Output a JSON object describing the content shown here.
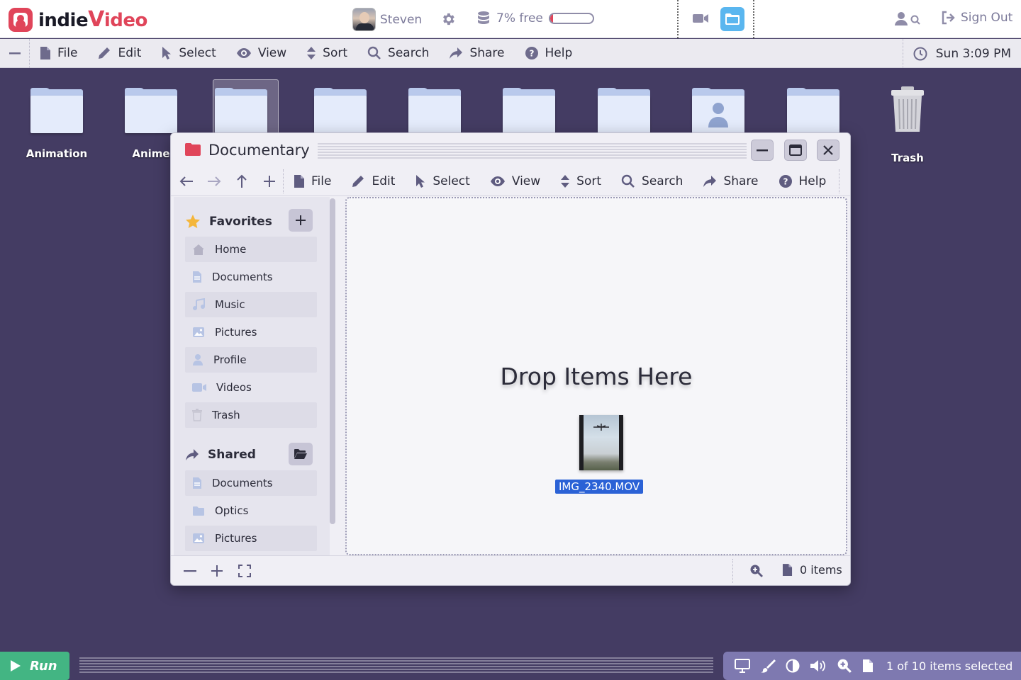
{
  "app": {
    "logo_indie": "indie",
    "logo_v": "V",
    "logo_ideo": "ideo"
  },
  "topbar": {
    "user_name": "Steven",
    "storage_text": "7% free",
    "storage_used_fraction": 0.07,
    "sign_out_label": "Sign Out"
  },
  "menubar": {
    "items": [
      {
        "label": "File",
        "icon": "file-icon"
      },
      {
        "label": "Edit",
        "icon": "pencil-icon"
      },
      {
        "label": "Select",
        "icon": "cursor-icon"
      },
      {
        "label": "View",
        "icon": "eye-icon"
      },
      {
        "label": "Sort",
        "icon": "sort-icon"
      },
      {
        "label": "Search",
        "icon": "search-icon"
      },
      {
        "label": "Share",
        "icon": "share-icon"
      },
      {
        "label": "Help",
        "icon": "help-icon"
      }
    ],
    "clock": "Sun 3:09 PM"
  },
  "desktop": {
    "icons": [
      {
        "label": "Animation",
        "type": "folder"
      },
      {
        "label": "Anime",
        "type": "folder"
      },
      {
        "label": "",
        "type": "folder",
        "selected": true
      },
      {
        "label": "",
        "type": "folder"
      },
      {
        "label": "",
        "type": "folder"
      },
      {
        "label": "",
        "type": "folder"
      },
      {
        "label": "",
        "type": "folder"
      },
      {
        "label": "",
        "type": "user-folder"
      },
      {
        "label": "",
        "type": "folder"
      },
      {
        "label": "Trash",
        "type": "trash"
      }
    ]
  },
  "window": {
    "title": "Documentary",
    "toolbar": {
      "items": [
        {
          "label": "File"
        },
        {
          "label": "Edit"
        },
        {
          "label": "Select"
        },
        {
          "label": "View"
        },
        {
          "label": "Sort"
        },
        {
          "label": "Search"
        },
        {
          "label": "Share"
        },
        {
          "label": "Help"
        }
      ]
    },
    "sidebar": {
      "favorites_title": "Favorites",
      "favorites": [
        {
          "label": "Home",
          "icon": "home-icon"
        },
        {
          "label": "Documents",
          "icon": "document-icon"
        },
        {
          "label": "Music",
          "icon": "music-icon"
        },
        {
          "label": "Pictures",
          "icon": "picture-icon"
        },
        {
          "label": "Profile",
          "icon": "profile-icon"
        },
        {
          "label": "Videos",
          "icon": "video-icon"
        },
        {
          "label": "Trash",
          "icon": "trash-icon"
        }
      ],
      "shared_title": "Shared",
      "shared": [
        {
          "label": "Documents",
          "icon": "document-icon"
        },
        {
          "label": "Optics",
          "icon": "folder-icon"
        },
        {
          "label": "Pictures",
          "icon": "picture-icon"
        }
      ]
    },
    "drop_text": "Drop Items Here",
    "dragged_file": "IMG_2340.MOV",
    "status_count": "0 items"
  },
  "bottombar": {
    "run_label": "Run",
    "selection_text": "1 of 10 items selected"
  },
  "colors": {
    "desktop_bg": "#443c63",
    "brand": "#e0455a",
    "run": "#43b583",
    "tray": "#7e79b0",
    "selection": "#2b62d6"
  }
}
